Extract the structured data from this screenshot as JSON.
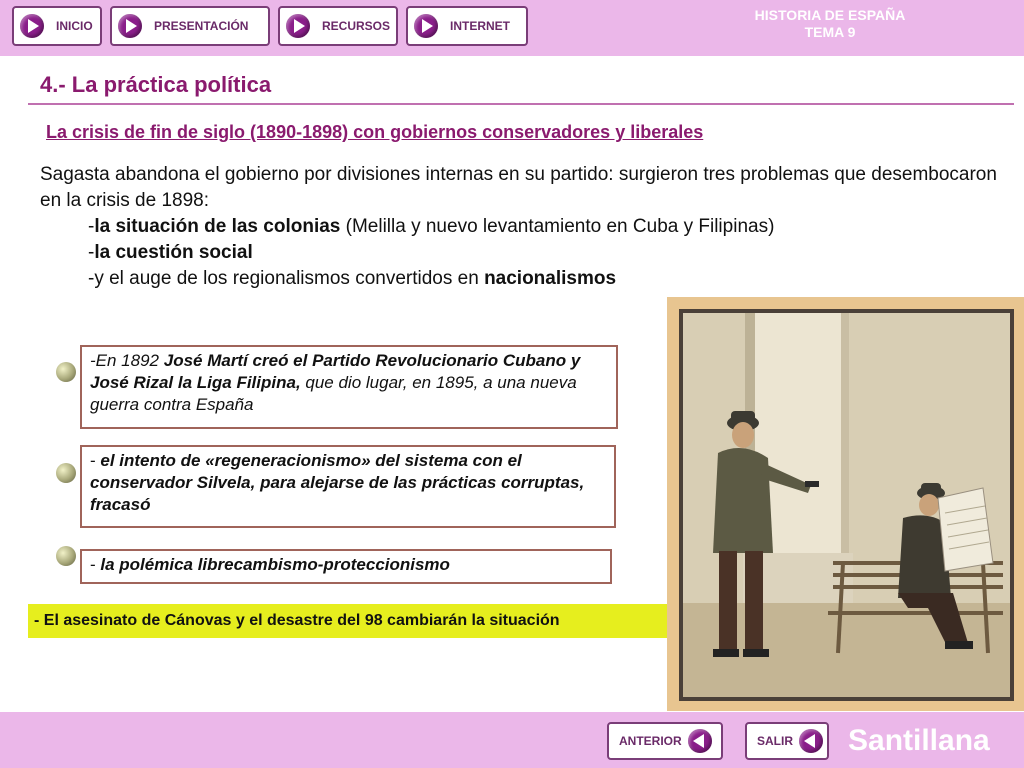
{
  "nav": {
    "inicio": "INICIO",
    "presentacion": "PRESENTACIÓN",
    "recursos": "RECURSOS",
    "internet": "INTERNET"
  },
  "header": {
    "line1": "HISTORIA DE ESPAÑA",
    "line2": "TEMA 9"
  },
  "section_title": "4.- La práctica política",
  "subtitle": "La crisis de fin de siglo (1890-1898) con gobiernos conservadores y liberales",
  "intro": {
    "paragraph": "Sagasta abandona el gobierno por divisiones internas en su partido: surgieron tres problemas que desembocaron en la crisis de 1898:",
    "b1_bold": "la situación de las colonias",
    "b1_rest": " (Melilla y nuevo levantamiento en Cuba y Filipinas)",
    "b2_bold": "la cuestión social",
    "b3_text": "-y el auge de los regionalismos convertidos en ",
    "b3_bold": "nacionalismos"
  },
  "boxes": {
    "box1_a": "-En 1892 ",
    "box1_b": "José Martí creó el Partido Revolucionario Cubano y José Rizal  la Liga Filipina,",
    "box1_c": " que dio lugar, en 1895, a una nueva guerra contra España",
    "box2_a": "- ",
    "box2_b": "el intento de «regeneracionismo» del sistema con el conservador Silvela, para alejarse de las prácticas corruptas, fracasó",
    "box3_a": "- ",
    "box3_b": "la polémica librecambismo-proteccionismo"
  },
  "highlight": "- El asesinato de Cánovas y el desastre del 98 cambiarán la situación",
  "footer": {
    "anterior": "ANTERIOR",
    "salir": "SALIR",
    "brand": "Santillana"
  },
  "colors": {
    "bar": "#ebb7e9",
    "accent": "#8a1a6e",
    "highlight": "#e6ee1e"
  }
}
